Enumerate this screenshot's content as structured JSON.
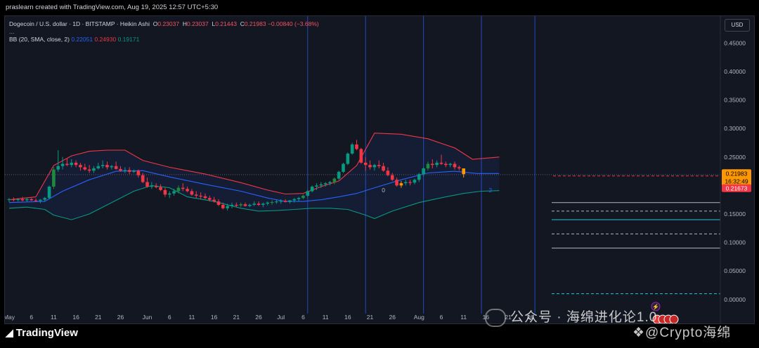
{
  "header": {
    "creator_line": "praslearn created with TradingView.com, Aug 19, 2025 12:57 UTC+5:30"
  },
  "legend": {
    "symbol": "Dogecoin / U.S. dollar · 1D · BITSTAMP · Heikin Ashi",
    "o_label": "O",
    "o_value": "0.23037",
    "h_label": "H",
    "h_value": "0.23037",
    "l_label": "L",
    "l_value": "0.21443",
    "c_label": "C",
    "c_value": "0.21983",
    "change": "−0.00840 (−3.68%)",
    "more": "...",
    "bb_label": "BB (20, SMA, close, 2)",
    "bb_basis": "0.22051",
    "bb_upper": "0.24930",
    "bb_lower": "0.19171"
  },
  "currency_button": "USD",
  "price_labels": {
    "last": "0.21983",
    "countdown": "16:32:49",
    "low_line": "0.21673"
  },
  "markers": {
    "zero": "0",
    "two": "2"
  },
  "footer": {
    "brand": "TradingView",
    "watermark_wechat": "公众号 · 海绵进化论1.0",
    "watermark_x": "@Crypto海绵"
  },
  "colors": {
    "background": "#131722",
    "up": "#089981",
    "up_dark": "#1e8a3e",
    "down": "#f23645",
    "orange": "#ff9800",
    "bb_upper": "#f23645",
    "bb_lower": "#089981",
    "bb_basis": "#2962ff",
    "vline": "#2962ff"
  },
  "chart_data": {
    "type": "candlestick",
    "title": "Dogecoin / U.S. dollar · 1D · BITSTAMP · Heikin Ashi",
    "ylim": [
      -0.02,
      0.48
    ],
    "y_ticks": [
      "0.45000",
      "0.40000",
      "0.35000",
      "0.30000",
      "0.25000",
      "0.20000",
      "0.15000",
      "0.10000",
      "0.05000",
      "0.00000"
    ],
    "y_tick_values": [
      0.45,
      0.4,
      0.35,
      0.3,
      0.25,
      0.2,
      0.15,
      0.1,
      0.05,
      0.0
    ],
    "x_ticks": [
      {
        "label": "May",
        "day": 0
      },
      {
        "label": "6",
        "day": 5
      },
      {
        "label": "11",
        "day": 10
      },
      {
        "label": "16",
        "day": 15
      },
      {
        "label": "21",
        "day": 20
      },
      {
        "label": "26",
        "day": 25
      },
      {
        "label": "Jun",
        "day": 31
      },
      {
        "label": "6",
        "day": 36
      },
      {
        "label": "11",
        "day": 41
      },
      {
        "label": "16",
        "day": 46
      },
      {
        "label": "21",
        "day": 51
      },
      {
        "label": "26",
        "day": 56
      },
      {
        "label": "Jul",
        "day": 61
      },
      {
        "label": "6",
        "day": 66
      },
      {
        "label": "11",
        "day": 71
      },
      {
        "label": "16",
        "day": 76
      },
      {
        "label": "21",
        "day": 81
      },
      {
        "label": "26",
        "day": 86
      },
      {
        "label": "Aug",
        "day": 92
      },
      {
        "label": "6",
        "day": 97
      },
      {
        "label": "11",
        "day": 102
      },
      {
        "label": "16",
        "day": 107
      },
      {
        "label": "21",
        "day": 112
      },
      {
        "label": "26",
        "day": 117
      }
    ],
    "vertical_lines_days": [
      67,
      80,
      93,
      106,
      118
    ],
    "horizontal_levels": [
      {
        "value": 0.219,
        "style": "dotted",
        "color": "#5d606b"
      },
      {
        "value": 0.2167,
        "style": "dashed",
        "color": "#f23645"
      },
      {
        "value": 0.17,
        "style": "solid",
        "color": "#b2b5be"
      },
      {
        "value": 0.155,
        "style": "dashed",
        "color": "#b2b5be"
      },
      {
        "value": 0.14,
        "style": "solid",
        "color": "#26c6da"
      },
      {
        "value": 0.115,
        "style": "dashed",
        "color": "#b2b5be"
      },
      {
        "value": 0.09,
        "style": "solid",
        "color": "#b2b5be"
      },
      {
        "value": 0.01,
        "style": "dashed",
        "color": "#26c6da"
      }
    ],
    "candles": [
      [
        0.175,
        0.178,
        0.171,
        0.176
      ],
      [
        0.176,
        0.179,
        0.172,
        0.175
      ],
      [
        0.175,
        0.178,
        0.172,
        0.176
      ],
      [
        0.176,
        0.18,
        0.172,
        0.174
      ],
      [
        0.174,
        0.178,
        0.171,
        0.176
      ],
      [
        0.176,
        0.178,
        0.173,
        0.174
      ],
      [
        0.174,
        0.177,
        0.171,
        0.173
      ],
      [
        0.173,
        0.176,
        0.169,
        0.175
      ],
      [
        0.175,
        0.18,
        0.172,
        0.178
      ],
      [
        0.178,
        0.2,
        0.176,
        0.198
      ],
      [
        0.198,
        0.232,
        0.194,
        0.228
      ],
      [
        0.228,
        0.262,
        0.224,
        0.234
      ],
      [
        0.234,
        0.25,
        0.228,
        0.238
      ],
      [
        0.238,
        0.248,
        0.234,
        0.236
      ],
      [
        0.236,
        0.246,
        0.232,
        0.24
      ],
      [
        0.24,
        0.244,
        0.232,
        0.236
      ],
      [
        0.236,
        0.24,
        0.226,
        0.232
      ],
      [
        0.232,
        0.238,
        0.226,
        0.228
      ],
      [
        0.228,
        0.236,
        0.222,
        0.226
      ],
      [
        0.226,
        0.234,
        0.222,
        0.23
      ],
      [
        0.23,
        0.24,
        0.228,
        0.234
      ],
      [
        0.234,
        0.244,
        0.23,
        0.236
      ],
      [
        0.236,
        0.242,
        0.228,
        0.232
      ],
      [
        0.232,
        0.236,
        0.228,
        0.234
      ],
      [
        0.234,
        0.242,
        0.228,
        0.229
      ],
      [
        0.229,
        0.234,
        0.224,
        0.226
      ],
      [
        0.226,
        0.232,
        0.222,
        0.227
      ],
      [
        0.227,
        0.232,
        0.22,
        0.224
      ],
      [
        0.224,
        0.228,
        0.222,
        0.226
      ],
      [
        0.226,
        0.228,
        0.214,
        0.218
      ],
      [
        0.218,
        0.222,
        0.204,
        0.206
      ],
      [
        0.206,
        0.214,
        0.196,
        0.198
      ],
      [
        0.198,
        0.206,
        0.194,
        0.199
      ],
      [
        0.199,
        0.204,
        0.195,
        0.197
      ],
      [
        0.197,
        0.202,
        0.19,
        0.192
      ],
      [
        0.192,
        0.196,
        0.18,
        0.184
      ],
      [
        0.184,
        0.19,
        0.178,
        0.186
      ],
      [
        0.186,
        0.194,
        0.182,
        0.19
      ],
      [
        0.19,
        0.2,
        0.186,
        0.196
      ],
      [
        0.196,
        0.204,
        0.19,
        0.194
      ],
      [
        0.194,
        0.198,
        0.188,
        0.19
      ],
      [
        0.19,
        0.194,
        0.182,
        0.184
      ],
      [
        0.184,
        0.19,
        0.178,
        0.182
      ],
      [
        0.182,
        0.188,
        0.176,
        0.181
      ],
      [
        0.181,
        0.186,
        0.176,
        0.178
      ],
      [
        0.178,
        0.182,
        0.172,
        0.175
      ],
      [
        0.175,
        0.18,
        0.17,
        0.172
      ],
      [
        0.172,
        0.176,
        0.164,
        0.166
      ],
      [
        0.166,
        0.17,
        0.158,
        0.16
      ],
      [
        0.16,
        0.168,
        0.156,
        0.164
      ],
      [
        0.164,
        0.17,
        0.16,
        0.166
      ],
      [
        0.166,
        0.17,
        0.162,
        0.165
      ],
      [
        0.165,
        0.17,
        0.162,
        0.167
      ],
      [
        0.167,
        0.17,
        0.163,
        0.164
      ],
      [
        0.164,
        0.168,
        0.162,
        0.166
      ],
      [
        0.166,
        0.172,
        0.164,
        0.168
      ],
      [
        0.168,
        0.172,
        0.164,
        0.166
      ],
      [
        0.166,
        0.17,
        0.162,
        0.168
      ],
      [
        0.168,
        0.172,
        0.165,
        0.17
      ],
      [
        0.17,
        0.174,
        0.166,
        0.171
      ],
      [
        0.171,
        0.175,
        0.168,
        0.172
      ],
      [
        0.172,
        0.176,
        0.168,
        0.173
      ],
      [
        0.173,
        0.176,
        0.17,
        0.171
      ],
      [
        0.171,
        0.174,
        0.168,
        0.174
      ],
      [
        0.174,
        0.178,
        0.17,
        0.176
      ],
      [
        0.176,
        0.18,
        0.172,
        0.178
      ],
      [
        0.178,
        0.184,
        0.176,
        0.182
      ],
      [
        0.182,
        0.192,
        0.18,
        0.19
      ],
      [
        0.19,
        0.2,
        0.188,
        0.198
      ],
      [
        0.198,
        0.204,
        0.192,
        0.2
      ],
      [
        0.2,
        0.206,
        0.196,
        0.202
      ],
      [
        0.202,
        0.206,
        0.198,
        0.204
      ],
      [
        0.204,
        0.208,
        0.2,
        0.206
      ],
      [
        0.206,
        0.214,
        0.202,
        0.212
      ],
      [
        0.212,
        0.226,
        0.21,
        0.224
      ],
      [
        0.224,
        0.24,
        0.222,
        0.238
      ],
      [
        0.238,
        0.258,
        0.236,
        0.256
      ],
      [
        0.256,
        0.275,
        0.254,
        0.272
      ],
      [
        0.272,
        0.28,
        0.262,
        0.264
      ],
      [
        0.264,
        0.266,
        0.238,
        0.24
      ],
      [
        0.24,
        0.25,
        0.226,
        0.236
      ],
      [
        0.236,
        0.244,
        0.228,
        0.232
      ],
      [
        0.232,
        0.238,
        0.226,
        0.236
      ],
      [
        0.236,
        0.244,
        0.23,
        0.234
      ],
      [
        0.234,
        0.24,
        0.224,
        0.226
      ],
      [
        0.226,
        0.232,
        0.216,
        0.218
      ],
      [
        0.218,
        0.222,
        0.208,
        0.21
      ],
      [
        0.21,
        0.214,
        0.198,
        0.2
      ],
      [
        0.2,
        0.208,
        0.196,
        0.204
      ],
      [
        0.204,
        0.21,
        0.2,
        0.206
      ],
      [
        0.206,
        0.21,
        0.2,
        0.205
      ],
      [
        0.205,
        0.212,
        0.202,
        0.21
      ],
      [
        0.21,
        0.222,
        0.206,
        0.22
      ],
      [
        0.22,
        0.232,
        0.216,
        0.23
      ],
      [
        0.23,
        0.242,
        0.226,
        0.238
      ],
      [
        0.238,
        0.246,
        0.23,
        0.236
      ],
      [
        0.236,
        0.244,
        0.232,
        0.24
      ],
      [
        0.24,
        0.254,
        0.236,
        0.238
      ],
      [
        0.238,
        0.242,
        0.232,
        0.236
      ],
      [
        0.236,
        0.24,
        0.232,
        0.238
      ],
      [
        0.238,
        0.242,
        0.228,
        0.232
      ],
      [
        0.232,
        0.235,
        0.226,
        0.23
      ],
      [
        0.23,
        0.23,
        0.214,
        0.22
      ]
    ],
    "bb_upper_points": [
      [
        0,
        0.175
      ],
      [
        6,
        0.18
      ],
      [
        10,
        0.235
      ],
      [
        14,
        0.252
      ],
      [
        18,
        0.26
      ],
      [
        22,
        0.262
      ],
      [
        26,
        0.262
      ],
      [
        30,
        0.244
      ],
      [
        36,
        0.232
      ],
      [
        44,
        0.22
      ],
      [
        52,
        0.205
      ],
      [
        58,
        0.192
      ],
      [
        62,
        0.185
      ],
      [
        66,
        0.186
      ],
      [
        70,
        0.198
      ],
      [
        74,
        0.208
      ],
      [
        78,
        0.235
      ],
      [
        82,
        0.292
      ],
      [
        88,
        0.29
      ],
      [
        94,
        0.282
      ],
      [
        100,
        0.266
      ],
      [
        104,
        0.246
      ],
      [
        110,
        0.25
      ]
    ],
    "bb_basis_points": [
      [
        0,
        0.17
      ],
      [
        8,
        0.172
      ],
      [
        12,
        0.19
      ],
      [
        18,
        0.21
      ],
      [
        24,
        0.225
      ],
      [
        30,
        0.226
      ],
      [
        36,
        0.215
      ],
      [
        44,
        0.202
      ],
      [
        52,
        0.19
      ],
      [
        58,
        0.178
      ],
      [
        62,
        0.172
      ],
      [
        66,
        0.172
      ],
      [
        70,
        0.175
      ],
      [
        74,
        0.18
      ],
      [
        78,
        0.186
      ],
      [
        82,
        0.196
      ],
      [
        88,
        0.21
      ],
      [
        94,
        0.222
      ],
      [
        100,
        0.225
      ],
      [
        105,
        0.221
      ],
      [
        110,
        0.221
      ]
    ],
    "bb_lower_points": [
      [
        0,
        0.16
      ],
      [
        4,
        0.162
      ],
      [
        8,
        0.158
      ],
      [
        10,
        0.148
      ],
      [
        14,
        0.14
      ],
      [
        18,
        0.15
      ],
      [
        24,
        0.174
      ],
      [
        28,
        0.19
      ],
      [
        32,
        0.2
      ],
      [
        36,
        0.196
      ],
      [
        40,
        0.18
      ],
      [
        46,
        0.172
      ],
      [
        52,
        0.16
      ],
      [
        56,
        0.155
      ],
      [
        60,
        0.156
      ],
      [
        64,
        0.158
      ],
      [
        68,
        0.16
      ],
      [
        72,
        0.16
      ],
      [
        76,
        0.158
      ],
      [
        80,
        0.148
      ],
      [
        82,
        0.142
      ],
      [
        86,
        0.155
      ],
      [
        92,
        0.17
      ],
      [
        98,
        0.18
      ],
      [
        102,
        0.186
      ],
      [
        106,
        0.19
      ],
      [
        110,
        0.191
      ]
    ]
  }
}
